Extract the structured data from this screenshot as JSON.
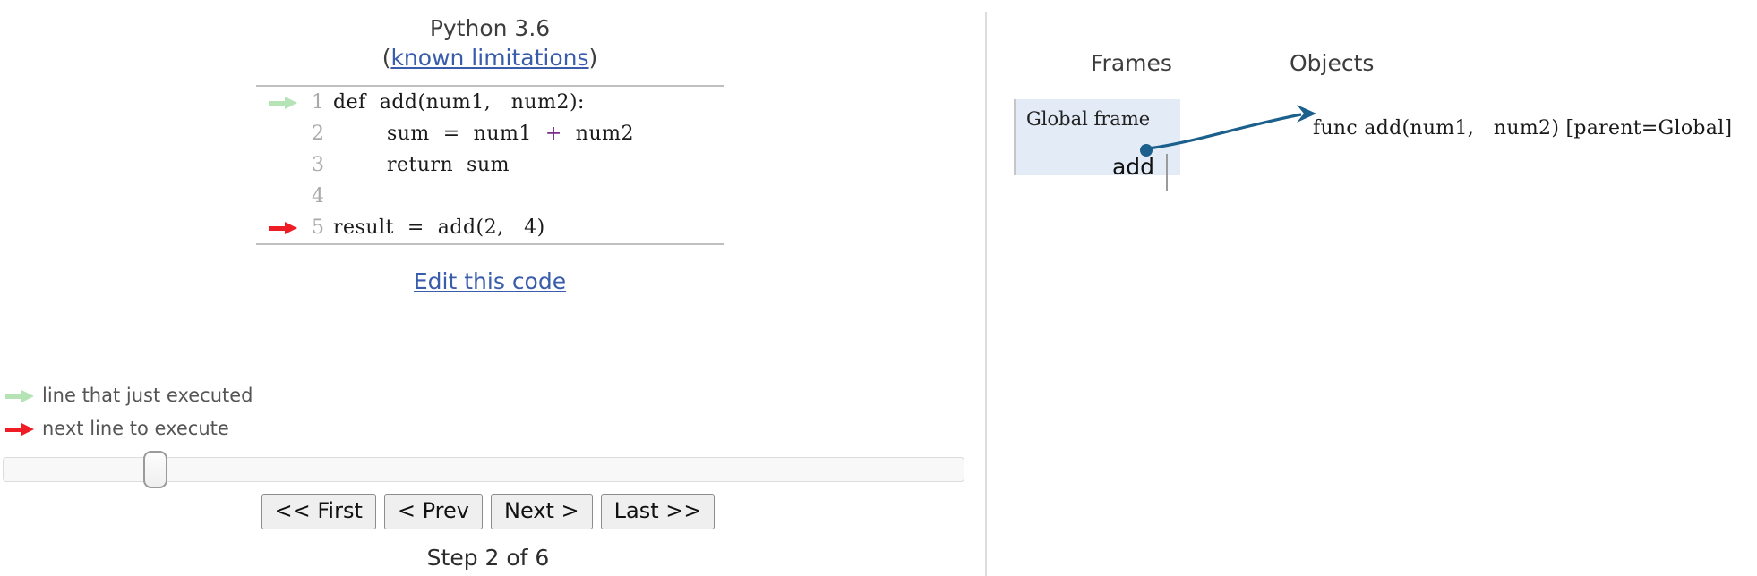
{
  "header": {
    "python_version": "Python 3.6",
    "known_limitations_prefix": "(",
    "known_limitations_link": "known limitations",
    "known_limitations_suffix": ")"
  },
  "code": {
    "lines": [
      {
        "number": "1",
        "text": "def  add(num1,   num2):",
        "arrow": "green"
      },
      {
        "number": "2",
        "text": "        sum  =  num1",
        "op": "  +  ",
        "text2": "num2",
        "arrow": "none"
      },
      {
        "number": "3",
        "text": "        return  sum",
        "arrow": "none"
      },
      {
        "number": "4",
        "text": "",
        "arrow": "none"
      },
      {
        "number": "5",
        "text": "result  =  add(2,   4)",
        "arrow": "red"
      }
    ],
    "edit_link": "Edit this code"
  },
  "legend": {
    "executed_label": "line that just executed",
    "next_label": "next line to execute",
    "executed_color": "#b5e3b5",
    "next_color": "#ee1c25"
  },
  "controls": {
    "first_label": "<< First",
    "prev_label": "< Prev",
    "next_label": "Next >",
    "last_label": "Last >>",
    "status": "Step 2 of 6",
    "slider_position_percent": 15
  },
  "visualization": {
    "frames_heading": "Frames",
    "objects_heading": "Objects",
    "global_frame_label": "Global frame",
    "global_frame_var": "add",
    "func_object": "func add(num1,   num2) [parent=Global]",
    "frame_bg_color": "#e3ebf6",
    "arrow_color": "#1b5f8c"
  }
}
